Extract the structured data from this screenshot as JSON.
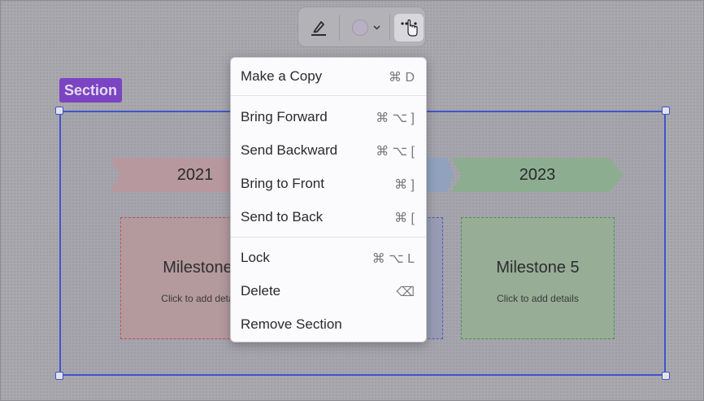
{
  "colors": {
    "section_label_bg": "#7a44c2",
    "section_border": "#3f55cc",
    "menu_bg": "#fbfbfd"
  },
  "toolbar": {
    "pen_icon": "pen-underline-icon",
    "color_icon": "color-swatch-icon",
    "more_icon": "more-options-icon"
  },
  "section": {
    "label": "Section"
  },
  "timeline": {
    "arrows": [
      {
        "year": "2021",
        "color": "#b7989f"
      },
      {
        "year": "",
        "color": "#90a2be"
      },
      {
        "year": "2023",
        "color": "#8dad90"
      }
    ],
    "cards": [
      {
        "title": "Milestone",
        "subtitle": "Click to add deta"
      },
      {
        "title": "",
        "subtitle": ""
      },
      {
        "title": "Milestone 5",
        "subtitle": "Click to add details"
      }
    ]
  },
  "menu": {
    "items": [
      {
        "label": "Make a Copy",
        "shortcut": "⌘ D"
      },
      {
        "label": "Bring Forward",
        "shortcut": "⌘ ⌥ ]"
      },
      {
        "label": "Send Backward",
        "shortcut": "⌘ ⌥ ["
      },
      {
        "label": "Bring to Front",
        "shortcut": "⌘ ]"
      },
      {
        "label": "Send to Back",
        "shortcut": "⌘ ["
      },
      {
        "label": "Lock",
        "shortcut": "⌘ ⌥ L"
      },
      {
        "label": "Delete",
        "shortcut": "⌫"
      },
      {
        "label": "Remove Section",
        "shortcut": ""
      }
    ]
  }
}
